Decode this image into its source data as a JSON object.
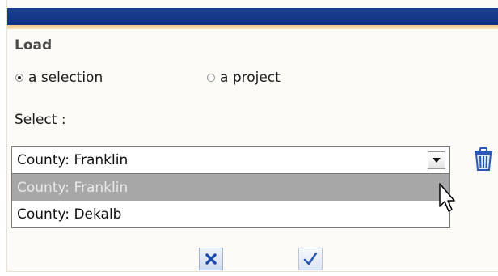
{
  "dialog": {
    "heading": "Load"
  },
  "load_type": {
    "options": [
      {
        "label": "a selection",
        "checked": true
      },
      {
        "label": "a project",
        "checked": false
      }
    ]
  },
  "selector": {
    "label": "Select :",
    "current_value": "County: Franklin",
    "options": [
      {
        "label": "County: Franklin",
        "highlighted": true
      },
      {
        "label": "County: Dekalb",
        "highlighted": false
      }
    ]
  },
  "icons": {
    "dropdown": "chevron-down-icon",
    "delete": "trash-icon",
    "cancel": "close-icon",
    "confirm": "check-icon",
    "pointer": "cursor-icon"
  },
  "colors": {
    "titlebar": "#123283",
    "accent_strip": "#f3c98a",
    "highlight_row": "#a7a7a7",
    "icon_blue": "#2a58b5"
  }
}
